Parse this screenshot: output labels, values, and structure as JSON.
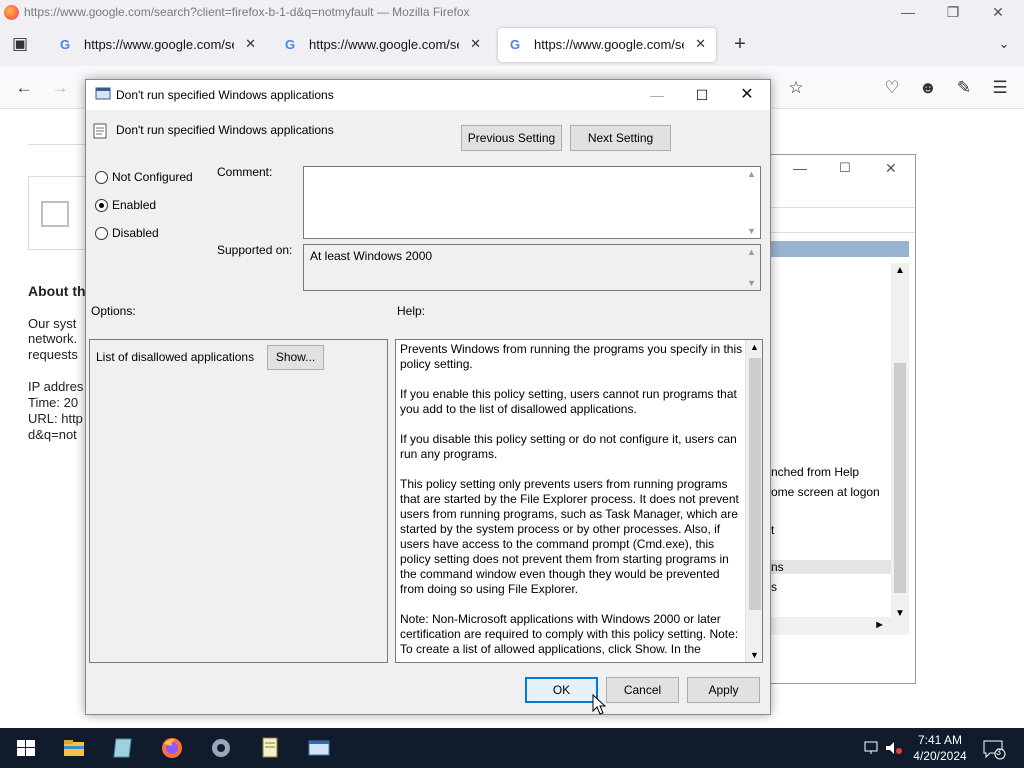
{
  "firefox": {
    "window_title": "https://www.google.com/search?client=firefox-b-1-d&q=notmyfault — Mozilla Firefox",
    "tabs": [
      {
        "label": "https://www.google.com/search"
      },
      {
        "label": "https://www.google.com/search"
      },
      {
        "label": "https://www.google.com/search"
      }
    ]
  },
  "page": {
    "heading": "About th",
    "lines": [
      "Our syst",
      "network.",
      "requests",
      "IP addres",
      "Time: 20",
      "URL: http",
      "d&q=not"
    ]
  },
  "bg_window": {
    "items": [
      "nched from Help",
      "ome screen at logon",
      "t",
      "ns",
      "s"
    ]
  },
  "dialog": {
    "title": "Don't run specified Windows applications",
    "policy_name": "Don't run specified Windows applications",
    "prev_button": "Previous Setting",
    "next_button": "Next Setting",
    "state_options": [
      {
        "label": "Not Configured",
        "checked": false
      },
      {
        "label": "Enabled",
        "checked": true
      },
      {
        "label": "Disabled",
        "checked": false
      }
    ],
    "comment_label": "Comment:",
    "comment_value": "",
    "supported_label": "Supported on:",
    "supported_value": "At least Windows 2000",
    "options_label": "Options:",
    "help_label": "Help:",
    "option_item_label": "List of disallowed applications",
    "show_button": "Show...",
    "help_paragraphs": [
      "Prevents Windows from running the programs you specify in this policy setting.",
      "If you enable this policy setting, users cannot run programs that you add to the list of disallowed applications.",
      "If you disable this policy setting or do not configure it, users can run any programs.",
      "This policy setting only prevents users from running programs that are started by the File Explorer process. It does not prevent users from running programs, such as Task Manager, which are started by the system process or by other processes.  Also, if users have access to the command prompt (Cmd.exe), this policy setting does not prevent them from starting programs in the command window even though they would be prevented from doing so using File Explorer.",
      "Note: Non-Microsoft applications with Windows 2000 or later certification are required to comply with this policy setting. Note: To create a list of allowed applications, click Show.  In the"
    ],
    "ok_button": "OK",
    "cancel_button": "Cancel",
    "apply_button": "Apply"
  },
  "taskbar": {
    "time": "7:41 AM",
    "date": "4/20/2024",
    "notification_count": "3"
  }
}
